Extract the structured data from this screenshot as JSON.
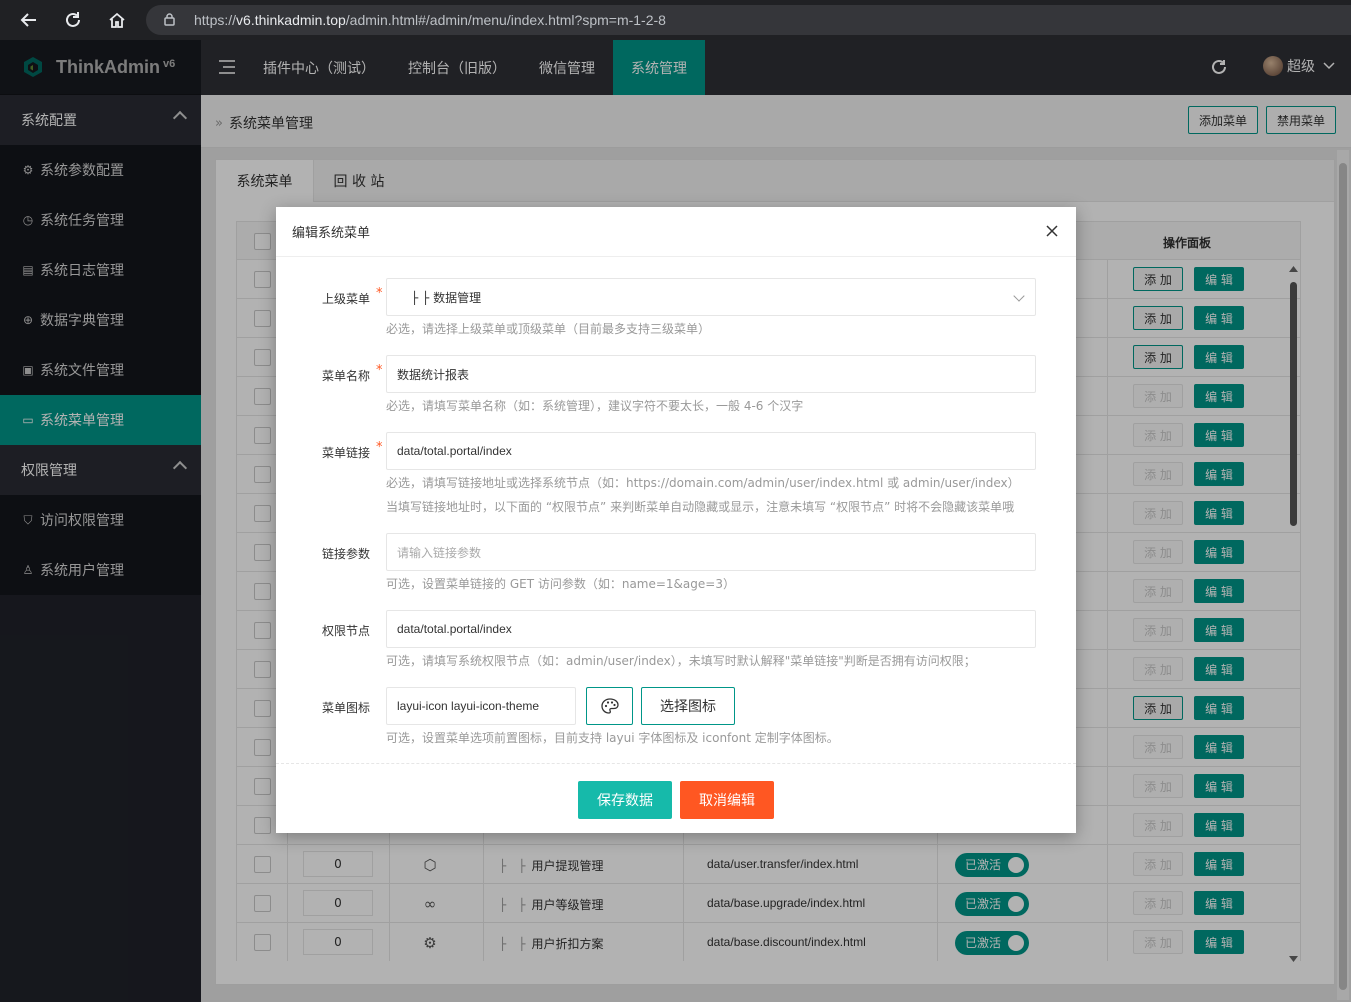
{
  "browser": {
    "url_prefix": "https://",
    "url_host": "v6.thinkadmin.top",
    "url_path": "/admin.html#/admin/menu/index.html?spm=m-1-2-8"
  },
  "app": {
    "logo_text": "ThinkAdmin",
    "logo_version": "v6"
  },
  "topnav": {
    "tabs": [
      "插件中心（测试）",
      "控制台（旧版）",
      "微信管理",
      "系统管理"
    ],
    "active_index": 3,
    "user_name": "超级"
  },
  "sidebar": {
    "groups": [
      {
        "label": "系统配置",
        "items": [
          {
            "label": "系统参数配置",
            "icon": "gear-icon"
          },
          {
            "label": "系统任务管理",
            "icon": "clock-icon"
          },
          {
            "label": "系统日志管理",
            "icon": "log-icon"
          },
          {
            "label": "数据字典管理",
            "icon": "code-icon"
          },
          {
            "label": "系统文件管理",
            "icon": "image-icon"
          },
          {
            "label": "系统菜单管理",
            "icon": "window-icon",
            "active": true
          }
        ]
      },
      {
        "label": "权限管理",
        "items": [
          {
            "label": "访问权限管理",
            "icon": "shield-icon"
          },
          {
            "label": "系统用户管理",
            "icon": "user-icon"
          }
        ]
      }
    ]
  },
  "page": {
    "breadcrumb": "系统菜单管理",
    "add_menu_button": "添加菜单",
    "disable_menu_button": "禁用菜单",
    "tabs": [
      "系统菜单",
      "回 收 站"
    ],
    "table_header_actions": "操作面板"
  },
  "table": {
    "add_label": "添 加",
    "edit_label": "编 辑",
    "status_label": "已激活",
    "add_enabled_rows": [
      0,
      1,
      2,
      11
    ],
    "visible_rows": [
      {
        "sort": "0",
        "icon": "cube-icon",
        "title": "用户提现管理",
        "url": "data/user.transfer/index.html"
      },
      {
        "sort": "0",
        "icon": "infinity-icon",
        "title": "用户等级管理",
        "url": "data/base.upgrade/index.html"
      },
      {
        "sort": "0",
        "icon": "gear-icon",
        "title": "用户折扣方案",
        "url": "data/base.discount/index.html"
      }
    ]
  },
  "modal": {
    "title": "编辑系统菜单",
    "parent": {
      "label": "上级菜单",
      "value": "├ ├ 数据管理",
      "help": "必选，请选择上级菜单或顶级菜单（目前最多支持三级菜单）"
    },
    "name": {
      "label": "菜单名称",
      "value": "数据统计报表",
      "help": "必选，请填写菜单名称（如：系统管理），建议字符不要太长，一般 4-6 个汉字"
    },
    "link": {
      "label": "菜单链接",
      "value": "data/total.portal/index",
      "help1": "必选，请填写链接地址或选择系统节点（如：https://domain.com/admin/user/index.html 或 admin/user/index）",
      "help2": "当填写链接地址时，以下面的 “权限节点” 来判断菜单自动隐藏或显示，注意未填写 “权限节点” 时将不会隐藏该菜单哦"
    },
    "params": {
      "label": "链接参数",
      "placeholder": "请输入链接参数",
      "help": "可选，设置菜单链接的 GET 访问参数（如：name=1&age=3）"
    },
    "node": {
      "label": "权限节点",
      "value": "data/total.portal/index",
      "help": "可选，请填写系统权限节点（如：admin/user/index），未填写时默认解释\"菜单链接\"判断是否拥有访问权限；"
    },
    "icon": {
      "label": "菜单图标",
      "value": "layui-icon layui-icon-theme",
      "select_button": "选择图标",
      "help": "可选，设置菜单选项前置图标，目前支持 layui 字体图标及 iconfont 定制字体图标。"
    },
    "save_button": "保存数据",
    "cancel_button": "取消编辑"
  },
  "colors": {
    "accent": "#009688",
    "danger": "#ff5722",
    "save": "#16baaa"
  }
}
